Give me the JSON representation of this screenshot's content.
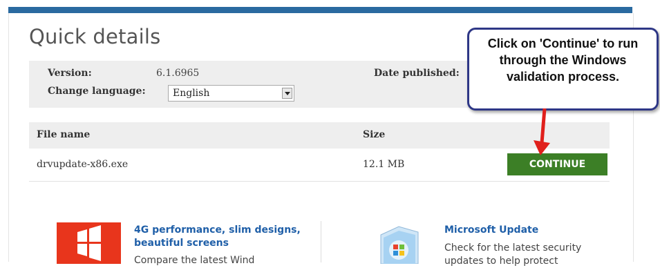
{
  "page": {
    "title": "Quick details"
  },
  "details": {
    "version_label": "Version:",
    "version_value": "6.1.6965",
    "language_label": "Change language:",
    "language_selected": "English",
    "date_label": "Date published:"
  },
  "files": {
    "columns": [
      "File name",
      "Size"
    ],
    "rows": [
      {
        "name": "drvupdate-x86.exe",
        "size": "12.1 MB"
      }
    ],
    "continue_label": "CONTINUE"
  },
  "callout": {
    "text": "Click on 'Continue' to run through the Windows validation process."
  },
  "promos": [
    {
      "title_line1": "4G performance, slim designs,",
      "title_line2": "beautiful screens",
      "text": "Compare the latest Wind"
    },
    {
      "title": "Microsoft Update",
      "text_line1": "Check for the latest security",
      "text_line2": "updates to help protect"
    }
  ],
  "colors": {
    "topbar": "#2a6aa0",
    "continue": "#3c7f26",
    "callout_border": "#2e3786",
    "arrow": "#e0201c",
    "link": "#1f5fa8"
  }
}
